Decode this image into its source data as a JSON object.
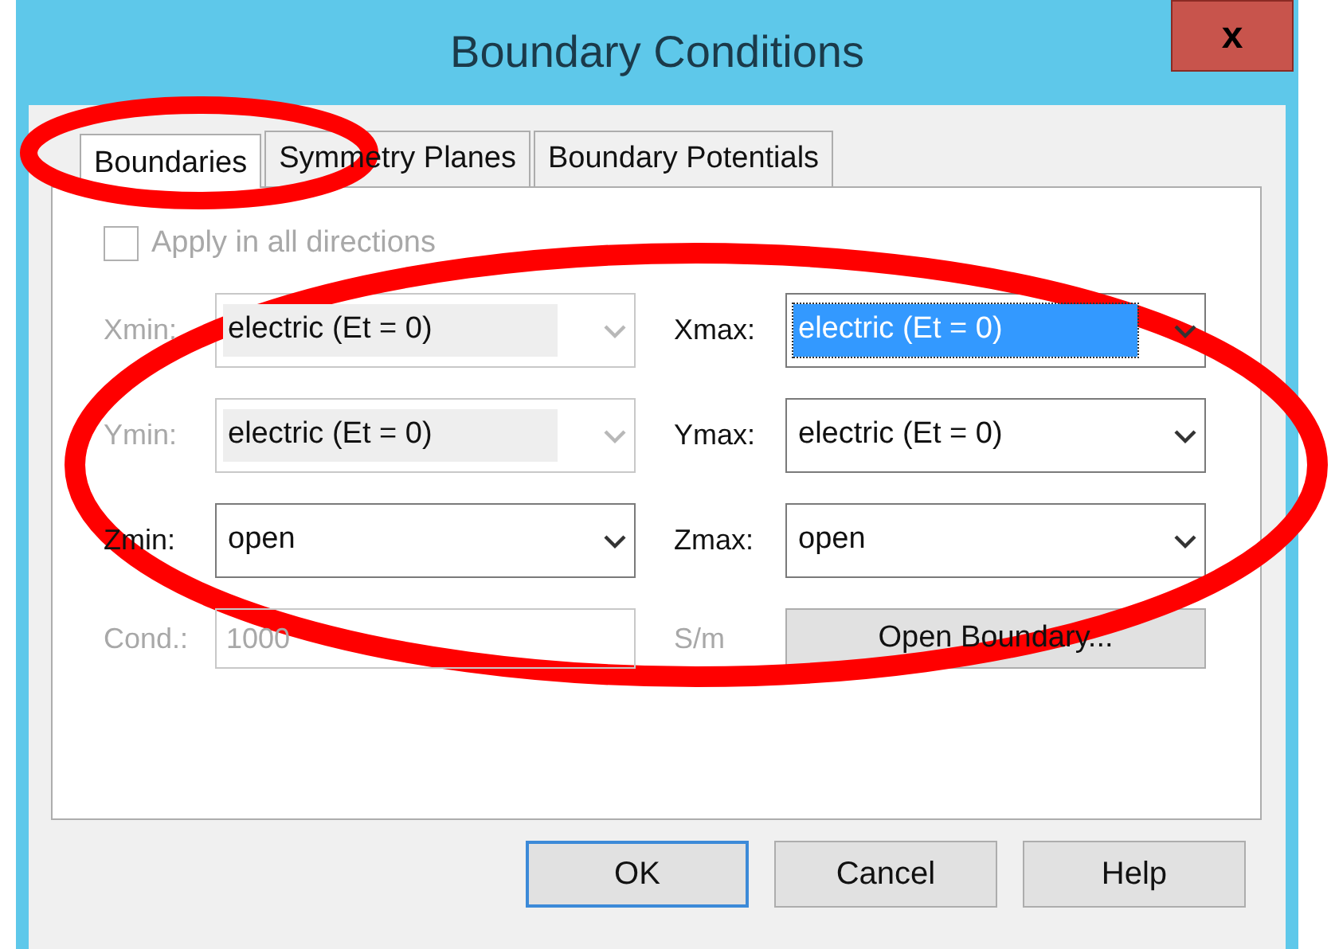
{
  "window": {
    "title": "Boundary Conditions",
    "close_label": "x"
  },
  "tabs": [
    {
      "label": "Boundaries",
      "selected": true
    },
    {
      "label": "Symmetry Planes",
      "selected": false
    },
    {
      "label": "Boundary Potentials",
      "selected": false
    }
  ],
  "apply_all": {
    "label": "Apply in all directions",
    "checked": false,
    "disabled": true
  },
  "fields": [
    {
      "label": "Xmin:",
      "value": "electric (Et = 0)",
      "disabled": true,
      "highlighted": false
    },
    {
      "label": "Xmax:",
      "value": "electric (Et = 0)",
      "disabled": false,
      "highlighted": true
    },
    {
      "label": "Ymin:",
      "value": "electric (Et = 0)",
      "disabled": true,
      "highlighted": false
    },
    {
      "label": "Ymax:",
      "value": "electric (Et = 0)",
      "disabled": false,
      "highlighted": false
    },
    {
      "label": "Zmin:",
      "value": "open",
      "disabled": false,
      "highlighted": false
    },
    {
      "label": "Zmax:",
      "value": "open",
      "disabled": false,
      "highlighted": false
    }
  ],
  "conductivity": {
    "label": "Cond.:",
    "value": "1000",
    "unit": "S/m",
    "disabled": true
  },
  "open_boundary_button": {
    "label": "Open Boundary..."
  },
  "buttons": [
    {
      "label": "OK",
      "default": true
    },
    {
      "label": "Cancel",
      "default": false
    },
    {
      "label": "Help",
      "default": false
    }
  ]
}
